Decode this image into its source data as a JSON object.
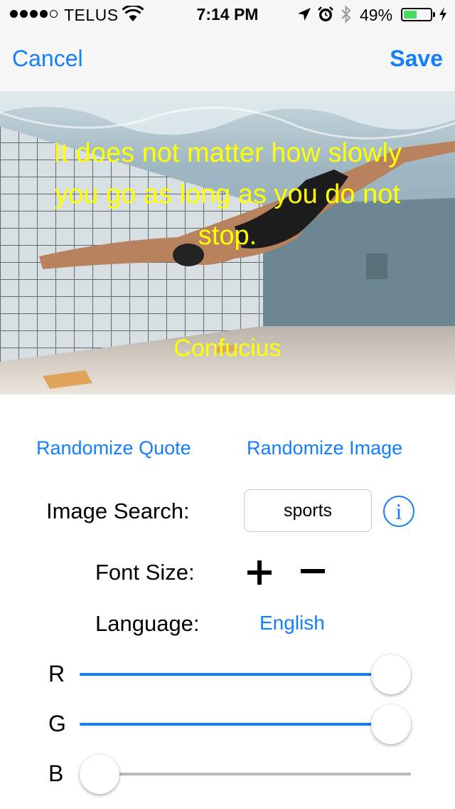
{
  "status_bar": {
    "carrier": "TELUS",
    "time": "7:14 PM",
    "battery": "49%",
    "battery_level": 0.49,
    "signal_bars": 4,
    "signal_max": 5,
    "icons": [
      "wifi-icon",
      "location-arrow-icon",
      "alarm-icon",
      "bluetooth-icon",
      "battery-icon",
      "charging-bolt-icon"
    ]
  },
  "nav": {
    "cancel_label": "Cancel",
    "save_label": "Save"
  },
  "photo": {
    "quote": "It does not matter how slowly you go as long as you do not stop.",
    "author": "Confucius",
    "text_color": "#ffff00"
  },
  "controls": {
    "randomize_quote_label": "Randomize Quote",
    "randomize_image_label": "Randomize Image",
    "image_search_label": "Image Search:",
    "image_search_value": "sports",
    "info_icon": "i",
    "font_size_label": "Font Size:",
    "language_label": "Language:",
    "language_value": "English"
  },
  "sliders": [
    {
      "label": "R",
      "value": 1.0
    },
    {
      "label": "G",
      "value": 1.0
    },
    {
      "label": "B",
      "value": 0.0
    }
  ],
  "colors": {
    "accent": "#147efb",
    "track": "#b7b7b7",
    "battery": "#4cd964"
  }
}
